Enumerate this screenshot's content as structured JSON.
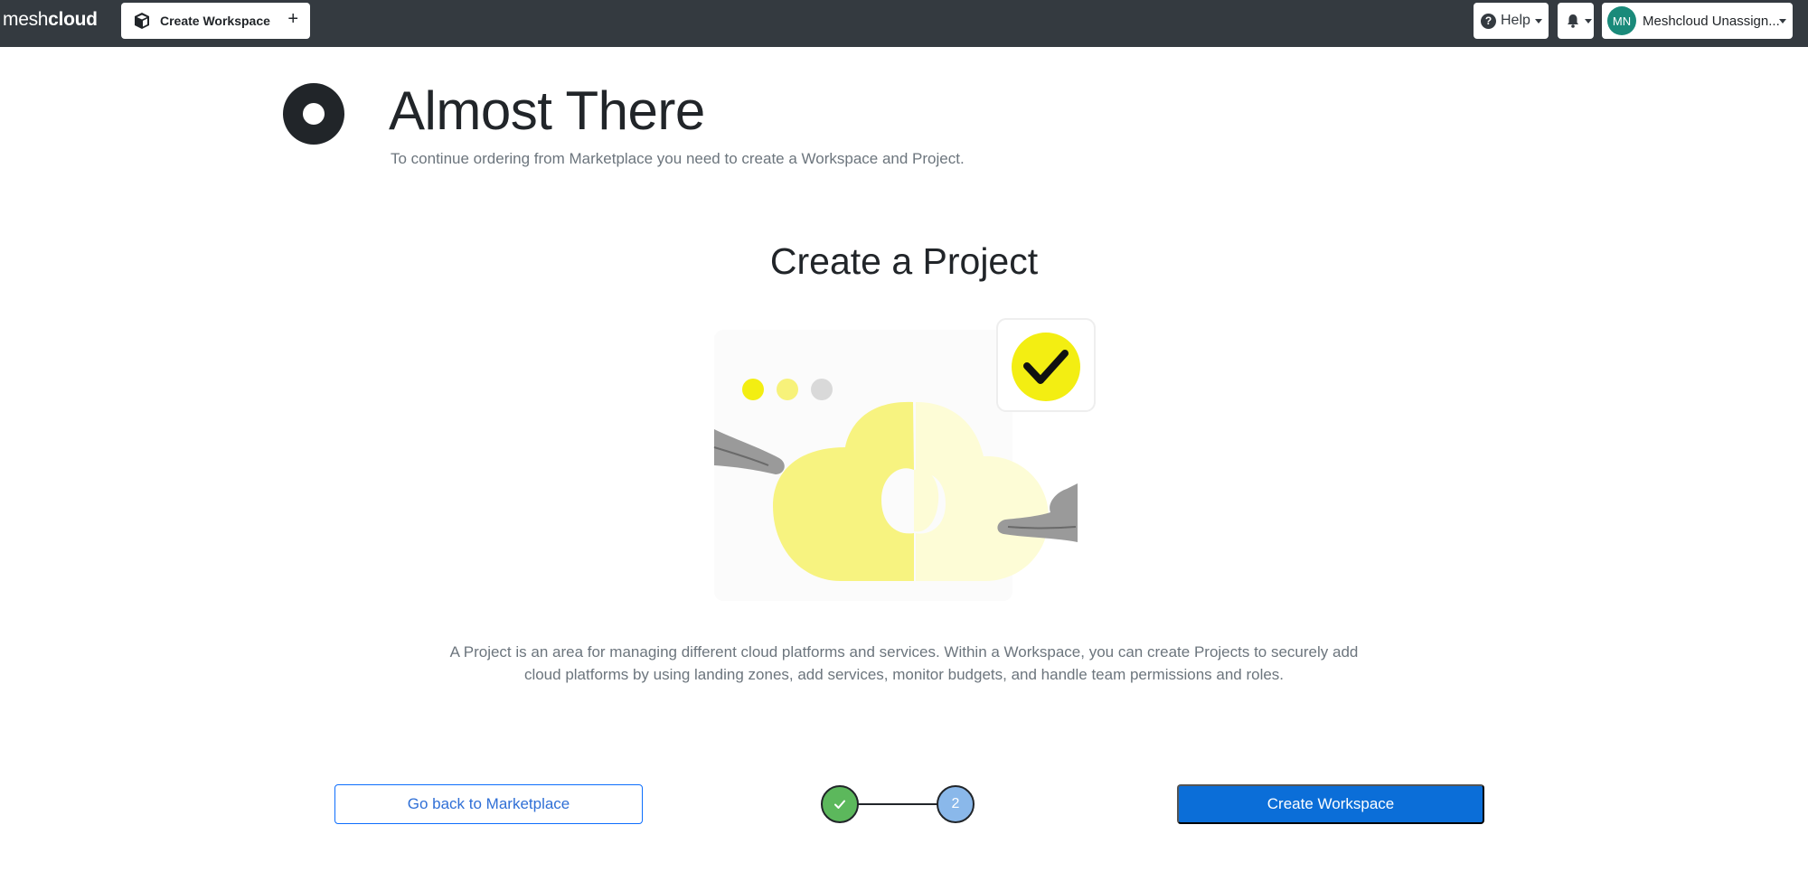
{
  "topbar": {
    "brand_light": "mesh",
    "brand_bold": "cloud",
    "tab_label": "Create Workspace",
    "tab_add": "+",
    "help_icon": "?",
    "help_label": "Help",
    "user_initials": "MN",
    "user_name": "Meshcloud Unassign..."
  },
  "header": {
    "title": "Almost There",
    "subtitle": "To continue ordering from Marketplace you need to create a Workspace and Project."
  },
  "section": {
    "title": "Create a Project",
    "description": "A Project is an area for managing different cloud platforms and services. Within a Workspace, you can create Projects to securely add cloud platforms by using landing zones, add services, monitor budgets, and handle team permissions and roles."
  },
  "actions": {
    "back_label": "Go back to Marketplace",
    "create_label": "Create Workspace"
  },
  "stepper": {
    "step1_icon": "check-icon",
    "step2_label": "2",
    "current_step": 2,
    "total_steps": 2
  },
  "colors": {
    "topbar": "#343a40",
    "primary": "#0b6ed8",
    "step_done": "#5cb85c",
    "step_current": "#8ab8ea",
    "accent_yellow": "#f5f10a"
  }
}
